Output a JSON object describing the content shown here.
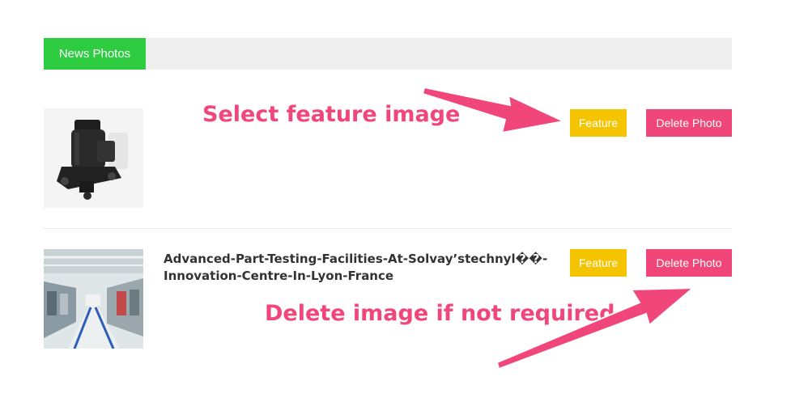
{
  "header": {
    "tab_label": "News Photos"
  },
  "photos": [
    {
      "title": "",
      "feature_label": "Feature",
      "delete_label": "Delete Photo"
    },
    {
      "title": "Advanced-Part-Testing-Facilities-At-Solvay’stechnyl��-Innovation-Centre-In-Lyon-France",
      "feature_label": "Feature",
      "delete_label": "Delete Photo"
    }
  ],
  "annotations": {
    "feature_hint": "Select feature image",
    "delete_hint": "Delete image if not required"
  },
  "colors": {
    "tab_green": "#2ecc40",
    "feature_yellow": "#f5c400",
    "delete_pink": "#f0467a",
    "annotation_pink": "#f0467a"
  }
}
